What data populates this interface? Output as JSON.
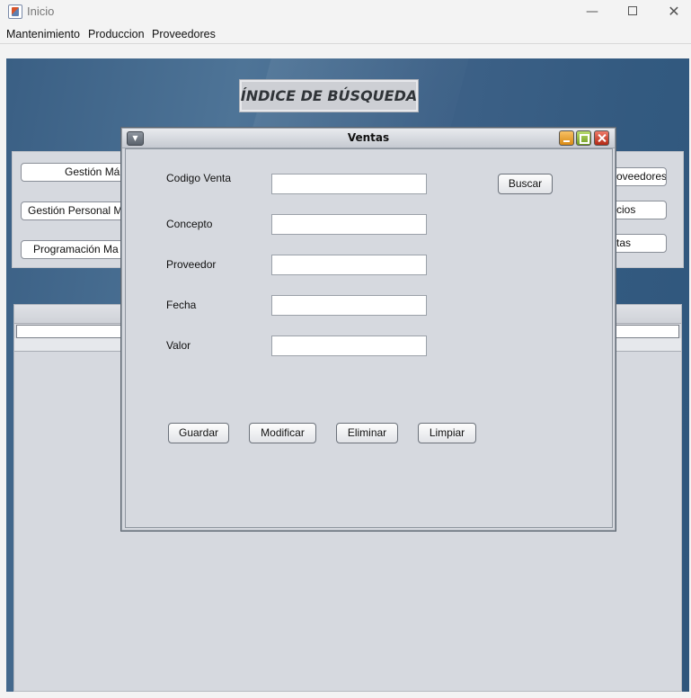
{
  "window": {
    "title": "Inicio",
    "controls": {
      "minimize": "—",
      "close": "✕"
    }
  },
  "menubar": {
    "items": [
      "Mantenimiento",
      "Produccion",
      "Proveedores"
    ]
  },
  "background": {
    "index_title": "ÍNDICE DE BÚSQUEDA",
    "left_buttons": [
      "Gestión Má",
      "Gestión Personal  M",
      "Programación Ma"
    ],
    "right_buttons": [
      "oveedores",
      "cios",
      "tas"
    ]
  },
  "ventas_frame": {
    "title": "Ventas",
    "fields": [
      {
        "label": "Codigo Venta",
        "value": ""
      },
      {
        "label": "Concepto",
        "value": ""
      },
      {
        "label": "Proveedor",
        "value": ""
      },
      {
        "label": "Fecha",
        "value": ""
      },
      {
        "label": "Valor",
        "value": ""
      }
    ],
    "search_button": "Buscar",
    "actions": [
      "Guardar",
      "Modificar",
      "Eliminar",
      "Limpiar"
    ]
  }
}
